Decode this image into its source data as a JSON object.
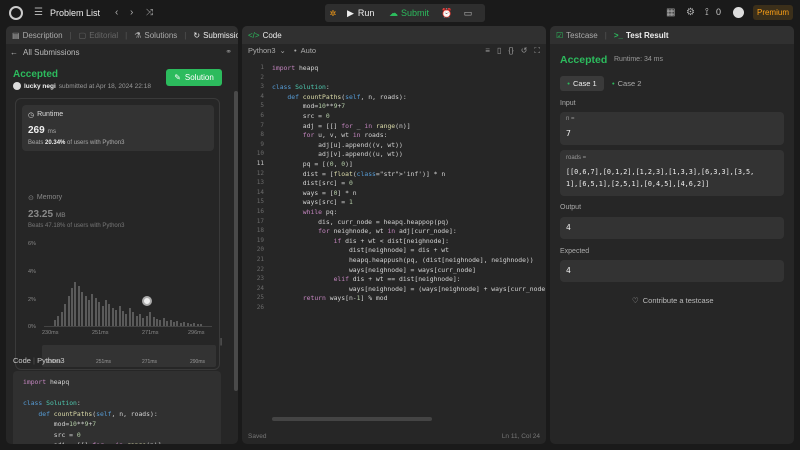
{
  "topbar": {
    "problem_list": "Problem List",
    "run": "Run",
    "submit": "Submit",
    "streak": "0",
    "premium": "Premium"
  },
  "left": {
    "tabs": [
      "Description",
      "Editorial",
      "Solutions",
      "Submissions"
    ],
    "back": "All Submissions",
    "status": "Accepted",
    "user": "lucky negi",
    "submitted": "submitted at Apr 18, 2024 22:18",
    "solution_btn": "Solution",
    "runtime": {
      "label": "Runtime",
      "value": "269",
      "unit": "ms",
      "beats_prefix": "Beats",
      "beats": "20.34%",
      "beats_suffix": "of users with Python3"
    },
    "memory": {
      "label": "Memory",
      "value": "23.25",
      "unit": "MB",
      "beats_prefix": "Beats",
      "beats": "47.18%",
      "beats_suffix": "of users with Python3"
    },
    "yticks": [
      "6%",
      "4%",
      "2%",
      "0%"
    ],
    "xticks": [
      "230ms",
      "251ms",
      "271ms",
      "296ms"
    ],
    "mini_xticks": [
      "230ms",
      "251ms",
      "271ms",
      "290ms"
    ],
    "code_label": "Code",
    "lang": "Python3",
    "code": [
      "import heapq",
      "",
      "class Solution:",
      "    def countPaths(self, n, roads):",
      "        mod=10**9+7",
      "        src = 0",
      "        adj = [[] for _ in range(n)]"
    ]
  },
  "editor": {
    "title": "Code",
    "lang": "Python3",
    "auto": "Auto",
    "saved": "Saved",
    "pos": "Ln 11, Col 24",
    "lines": [
      "import heapq",
      "",
      "class Solution:",
      "    def countPaths(self, n, roads):",
      "        mod=10**9+7",
      "        src = 0",
      "        adj = [[] for _ in range(n)]",
      "        for u, v, wt in roads:",
      "            adj[u].append((v, wt))",
      "            adj[v].append((u, wt))",
      "        pq = [(0, 0)]",
      "        dist = [float('inf')] * n",
      "        dist[src] = 0",
      "        ways = [0] * n",
      "        ways[src] = 1",
      "        while pq:",
      "            dis, curr_node = heapq.heappop(pq)",
      "            for neighnode, wt in adj[curr_node]:",
      "                if dis + wt < dist[neighnode]:",
      "                    dist[neighnode] = dis + wt",
      "                    heapq.heappush(pq, (dist[neighnode], neighnode))",
      "                    ways[neighnode] = ways[curr_node]",
      "                elif dis + wt == dist[neighnode]:",
      "                    ways[neighnode] = (ways[neighnode] + ways[curr_node])",
      "        return ways[n-1] % mod",
      ""
    ]
  },
  "right": {
    "tab_testcase": "Testcase",
    "tab_result": "Test Result",
    "status": "Accepted",
    "runtime": "Runtime: 34 ms",
    "case1": "Case 1",
    "case2": "Case 2",
    "input_label": "Input",
    "n_label": "n =",
    "n_value": "7",
    "roads_label": "roads =",
    "roads_line1": "[[0,6,7],[0,1,2],[1,2,3],[1,3,3],[6,3,3],[3,5,",
    "roads_line2": "1],[6,5,1],[2,5,1],[0,4,5],[4,6,2]]",
    "output_label": "Output",
    "output_value": "4",
    "expected_label": "Expected",
    "expected_value": "4",
    "contribute": "Contribute a testcase"
  },
  "colors": {
    "accent_green": "#2cbb5d",
    "accent_orange": "#ffa116",
    "panel": "#262626",
    "bg": "#1a1a1a"
  }
}
